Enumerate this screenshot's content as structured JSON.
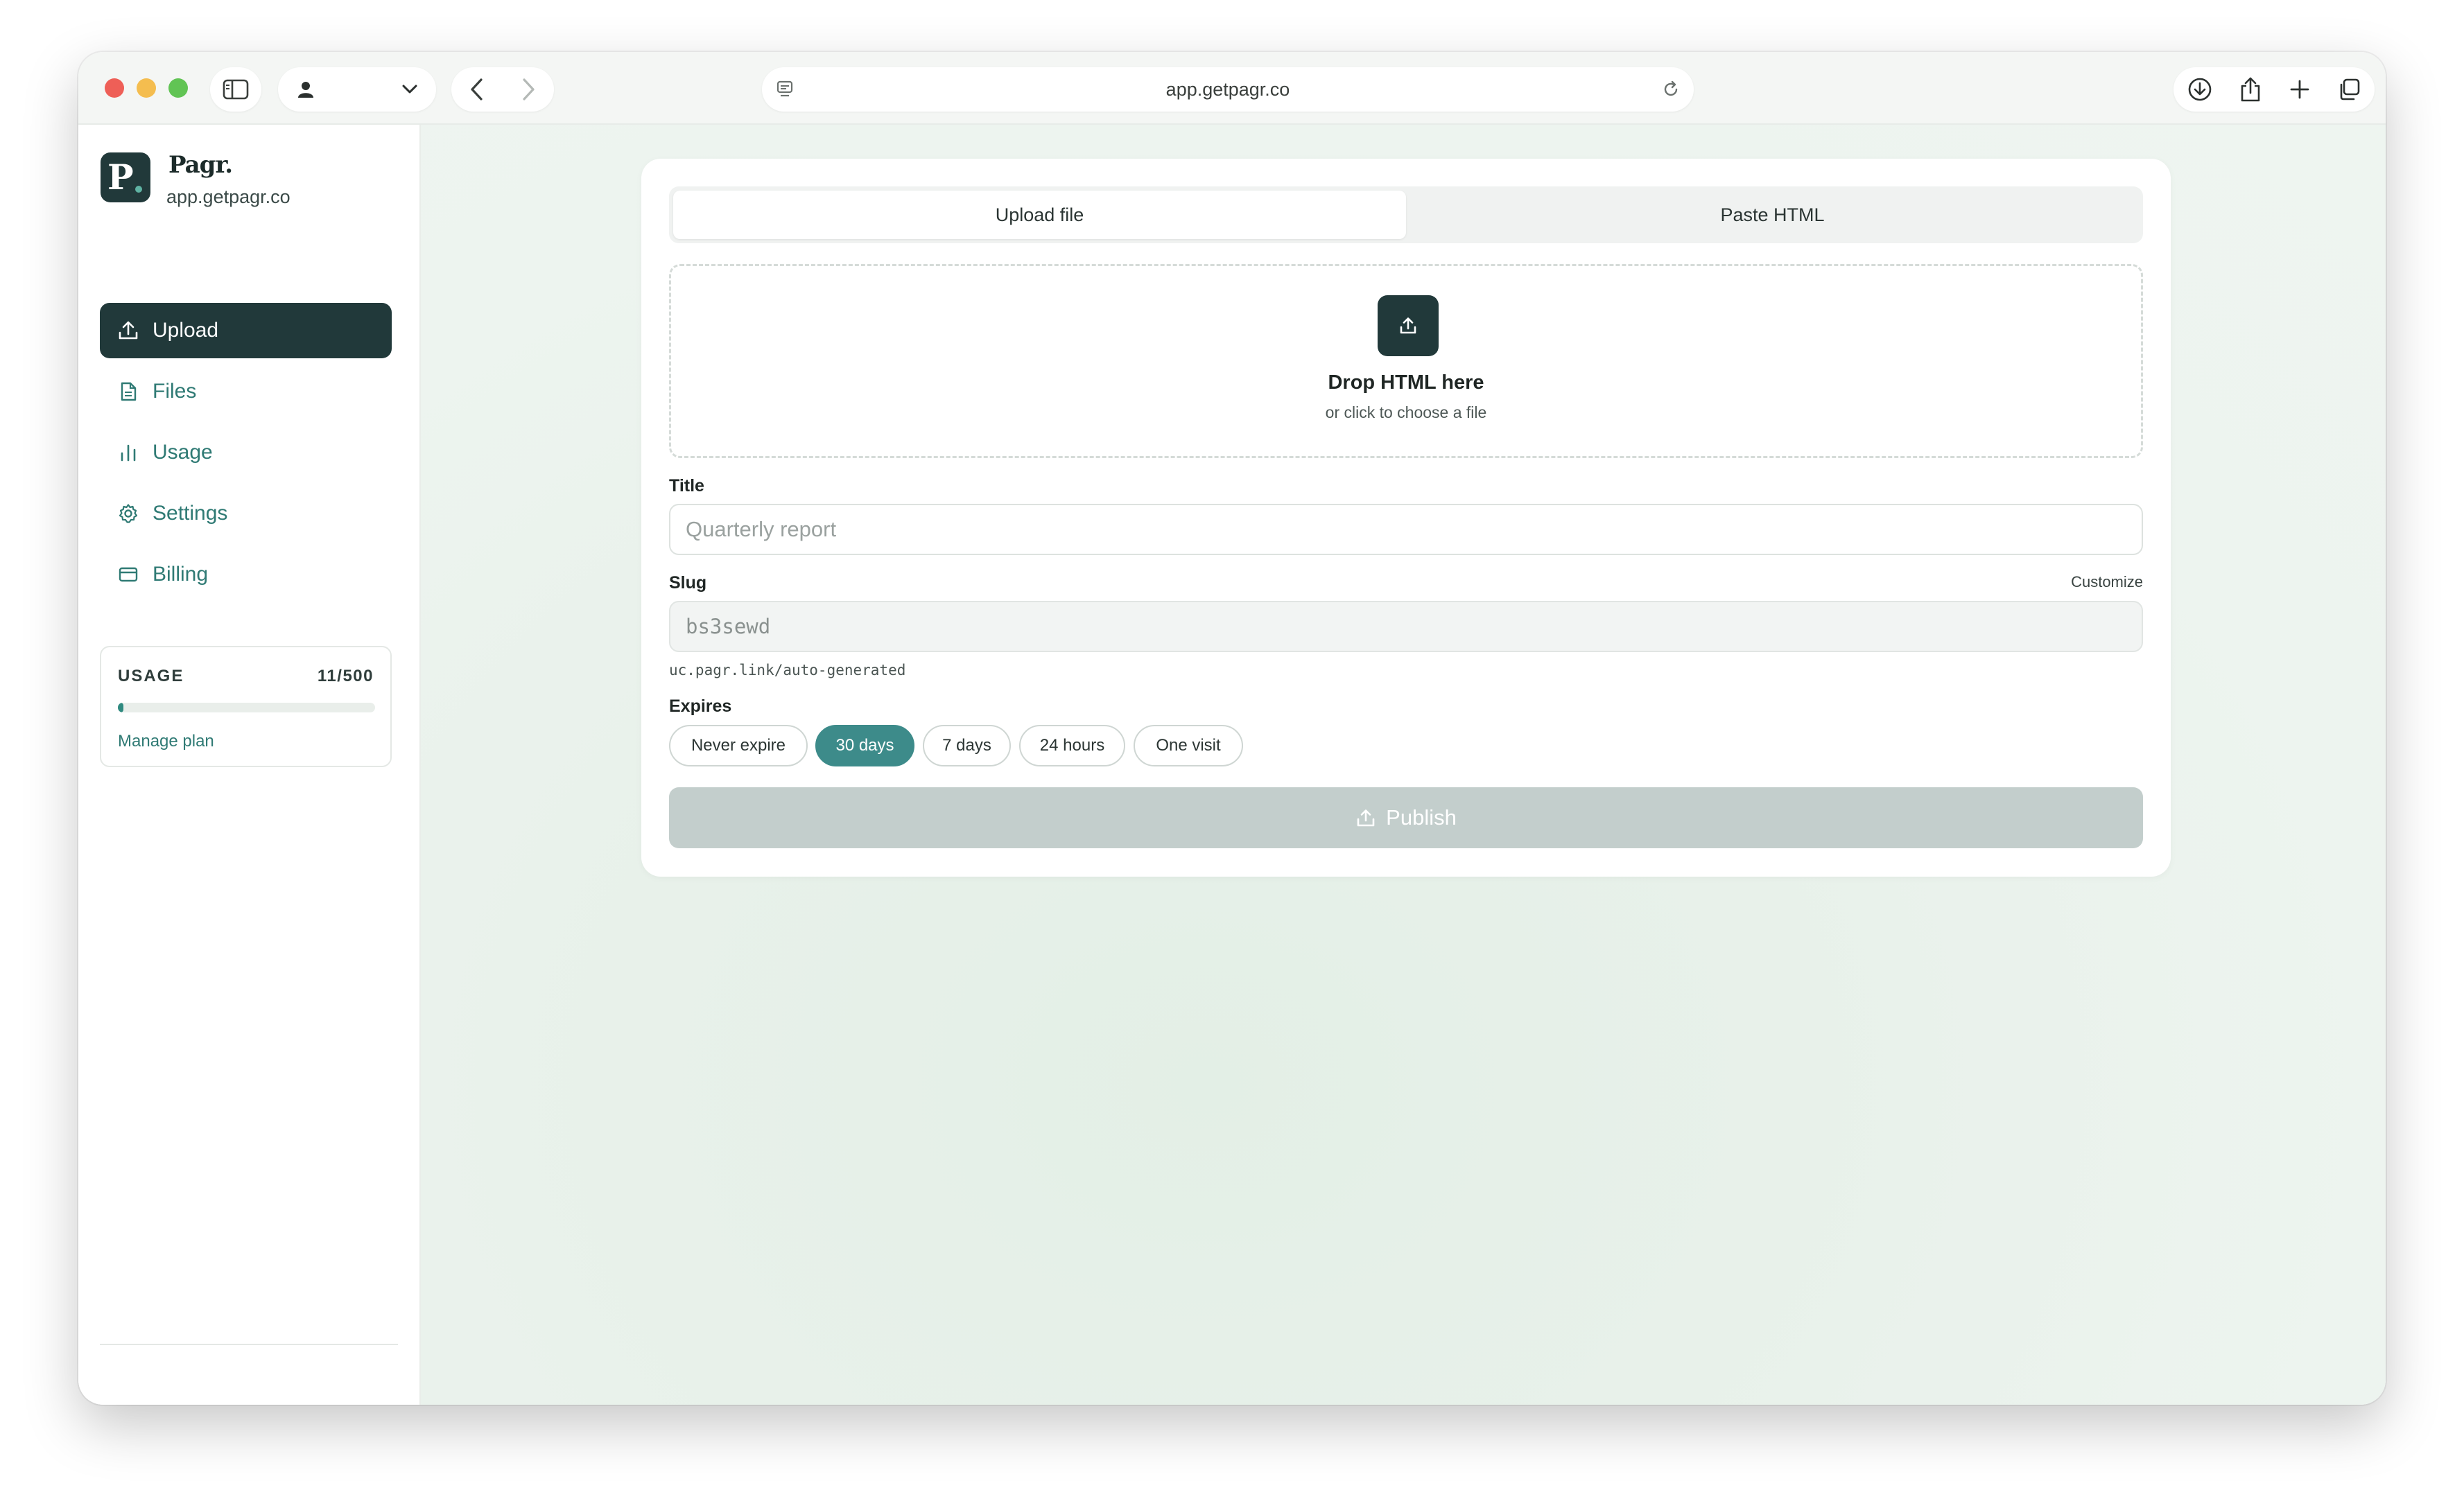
{
  "browser": {
    "address": "app.getpagr.co"
  },
  "sidebar": {
    "brand_letter": "P",
    "brand_name": "Pagr.",
    "brand_domain": "app.getpagr.co",
    "items": [
      {
        "label": "Upload",
        "icon": "upload-icon",
        "active": true
      },
      {
        "label": "Files",
        "icon": "file-icon",
        "active": false
      },
      {
        "label": "Usage",
        "icon": "bar-chart-icon",
        "active": false
      },
      {
        "label": "Settings",
        "icon": "gear-icon",
        "active": false
      },
      {
        "label": "Billing",
        "icon": "credit-card-icon",
        "active": false
      }
    ],
    "usage": {
      "title": "USAGE",
      "count": "11/500",
      "used": 11,
      "limit": 500,
      "manage_label": "Manage plan"
    }
  },
  "main": {
    "tabs": [
      {
        "label": "Upload file",
        "active": true
      },
      {
        "label": "Paste HTML",
        "active": false
      }
    ],
    "dropzone": {
      "title": "Drop HTML here",
      "subtitle": "or click to choose a file"
    },
    "title_field": {
      "label": "Title",
      "placeholder": "Quarterly report"
    },
    "slug_field": {
      "label": "Slug",
      "customize_label": "Customize",
      "value": "bs3sewd",
      "hint": "uc.pagr.link/auto-generated"
    },
    "expires": {
      "label": "Expires",
      "options": [
        "Never expire",
        "30 days",
        "7 days",
        "24 hours",
        "One visit"
      ],
      "selected": "30 days"
    },
    "publish_label": "Publish"
  },
  "colors": {
    "accent_dark": "#21393a",
    "accent_teal": "#3d8b8a",
    "link": "#2f7a74",
    "publish_disabled": "#c3cecc"
  }
}
